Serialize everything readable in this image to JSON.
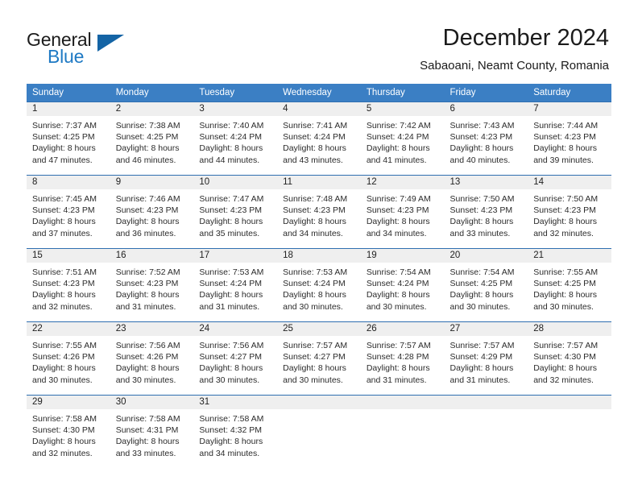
{
  "brand": {
    "name_part1": "General",
    "name_part2": "Blue",
    "triangle_icon": "triangle-icon",
    "color_dark": "#1b1b1b",
    "color_blue": "#1f7ac4",
    "triangle_color": "#1464a5"
  },
  "header": {
    "title": "December 2024",
    "subtitle": "Sabaoani, Neamt County, Romania"
  },
  "calendar": {
    "header_bg": "#3b7fc4",
    "header_text_color": "#ffffff",
    "daynum_band_bg": "#efefef",
    "row_border_color": "#2f6fb0",
    "weekdays": [
      "Sunday",
      "Monday",
      "Tuesday",
      "Wednesday",
      "Thursday",
      "Friday",
      "Saturday"
    ],
    "weeks": [
      [
        {
          "day": "1",
          "sunrise": "Sunrise: 7:37 AM",
          "sunset": "Sunset: 4:25 PM",
          "daylight_1": "Daylight: 8 hours",
          "daylight_2": "and 47 minutes."
        },
        {
          "day": "2",
          "sunrise": "Sunrise: 7:38 AM",
          "sunset": "Sunset: 4:25 PM",
          "daylight_1": "Daylight: 8 hours",
          "daylight_2": "and 46 minutes."
        },
        {
          "day": "3",
          "sunrise": "Sunrise: 7:40 AM",
          "sunset": "Sunset: 4:24 PM",
          "daylight_1": "Daylight: 8 hours",
          "daylight_2": "and 44 minutes."
        },
        {
          "day": "4",
          "sunrise": "Sunrise: 7:41 AM",
          "sunset": "Sunset: 4:24 PM",
          "daylight_1": "Daylight: 8 hours",
          "daylight_2": "and 43 minutes."
        },
        {
          "day": "5",
          "sunrise": "Sunrise: 7:42 AM",
          "sunset": "Sunset: 4:24 PM",
          "daylight_1": "Daylight: 8 hours",
          "daylight_2": "and 41 minutes."
        },
        {
          "day": "6",
          "sunrise": "Sunrise: 7:43 AM",
          "sunset": "Sunset: 4:23 PM",
          "daylight_1": "Daylight: 8 hours",
          "daylight_2": "and 40 minutes."
        },
        {
          "day": "7",
          "sunrise": "Sunrise: 7:44 AM",
          "sunset": "Sunset: 4:23 PM",
          "daylight_1": "Daylight: 8 hours",
          "daylight_2": "and 39 minutes."
        }
      ],
      [
        {
          "day": "8",
          "sunrise": "Sunrise: 7:45 AM",
          "sunset": "Sunset: 4:23 PM",
          "daylight_1": "Daylight: 8 hours",
          "daylight_2": "and 37 minutes."
        },
        {
          "day": "9",
          "sunrise": "Sunrise: 7:46 AM",
          "sunset": "Sunset: 4:23 PM",
          "daylight_1": "Daylight: 8 hours",
          "daylight_2": "and 36 minutes."
        },
        {
          "day": "10",
          "sunrise": "Sunrise: 7:47 AM",
          "sunset": "Sunset: 4:23 PM",
          "daylight_1": "Daylight: 8 hours",
          "daylight_2": "and 35 minutes."
        },
        {
          "day": "11",
          "sunrise": "Sunrise: 7:48 AM",
          "sunset": "Sunset: 4:23 PM",
          "daylight_1": "Daylight: 8 hours",
          "daylight_2": "and 34 minutes."
        },
        {
          "day": "12",
          "sunrise": "Sunrise: 7:49 AM",
          "sunset": "Sunset: 4:23 PM",
          "daylight_1": "Daylight: 8 hours",
          "daylight_2": "and 34 minutes."
        },
        {
          "day": "13",
          "sunrise": "Sunrise: 7:50 AM",
          "sunset": "Sunset: 4:23 PM",
          "daylight_1": "Daylight: 8 hours",
          "daylight_2": "and 33 minutes."
        },
        {
          "day": "14",
          "sunrise": "Sunrise: 7:50 AM",
          "sunset": "Sunset: 4:23 PM",
          "daylight_1": "Daylight: 8 hours",
          "daylight_2": "and 32 minutes."
        }
      ],
      [
        {
          "day": "15",
          "sunrise": "Sunrise: 7:51 AM",
          "sunset": "Sunset: 4:23 PM",
          "daylight_1": "Daylight: 8 hours",
          "daylight_2": "and 32 minutes."
        },
        {
          "day": "16",
          "sunrise": "Sunrise: 7:52 AM",
          "sunset": "Sunset: 4:23 PM",
          "daylight_1": "Daylight: 8 hours",
          "daylight_2": "and 31 minutes."
        },
        {
          "day": "17",
          "sunrise": "Sunrise: 7:53 AM",
          "sunset": "Sunset: 4:24 PM",
          "daylight_1": "Daylight: 8 hours",
          "daylight_2": "and 31 minutes."
        },
        {
          "day": "18",
          "sunrise": "Sunrise: 7:53 AM",
          "sunset": "Sunset: 4:24 PM",
          "daylight_1": "Daylight: 8 hours",
          "daylight_2": "and 30 minutes."
        },
        {
          "day": "19",
          "sunrise": "Sunrise: 7:54 AM",
          "sunset": "Sunset: 4:24 PM",
          "daylight_1": "Daylight: 8 hours",
          "daylight_2": "and 30 minutes."
        },
        {
          "day": "20",
          "sunrise": "Sunrise: 7:54 AM",
          "sunset": "Sunset: 4:25 PM",
          "daylight_1": "Daylight: 8 hours",
          "daylight_2": "and 30 minutes."
        },
        {
          "day": "21",
          "sunrise": "Sunrise: 7:55 AM",
          "sunset": "Sunset: 4:25 PM",
          "daylight_1": "Daylight: 8 hours",
          "daylight_2": "and 30 minutes."
        }
      ],
      [
        {
          "day": "22",
          "sunrise": "Sunrise: 7:55 AM",
          "sunset": "Sunset: 4:26 PM",
          "daylight_1": "Daylight: 8 hours",
          "daylight_2": "and 30 minutes."
        },
        {
          "day": "23",
          "sunrise": "Sunrise: 7:56 AM",
          "sunset": "Sunset: 4:26 PM",
          "daylight_1": "Daylight: 8 hours",
          "daylight_2": "and 30 minutes."
        },
        {
          "day": "24",
          "sunrise": "Sunrise: 7:56 AM",
          "sunset": "Sunset: 4:27 PM",
          "daylight_1": "Daylight: 8 hours",
          "daylight_2": "and 30 minutes."
        },
        {
          "day": "25",
          "sunrise": "Sunrise: 7:57 AM",
          "sunset": "Sunset: 4:27 PM",
          "daylight_1": "Daylight: 8 hours",
          "daylight_2": "and 30 minutes."
        },
        {
          "day": "26",
          "sunrise": "Sunrise: 7:57 AM",
          "sunset": "Sunset: 4:28 PM",
          "daylight_1": "Daylight: 8 hours",
          "daylight_2": "and 31 minutes."
        },
        {
          "day": "27",
          "sunrise": "Sunrise: 7:57 AM",
          "sunset": "Sunset: 4:29 PM",
          "daylight_1": "Daylight: 8 hours",
          "daylight_2": "and 31 minutes."
        },
        {
          "day": "28",
          "sunrise": "Sunrise: 7:57 AM",
          "sunset": "Sunset: 4:30 PM",
          "daylight_1": "Daylight: 8 hours",
          "daylight_2": "and 32 minutes."
        }
      ],
      [
        {
          "day": "29",
          "sunrise": "Sunrise: 7:58 AM",
          "sunset": "Sunset: 4:30 PM",
          "daylight_1": "Daylight: 8 hours",
          "daylight_2": "and 32 minutes."
        },
        {
          "day": "30",
          "sunrise": "Sunrise: 7:58 AM",
          "sunset": "Sunset: 4:31 PM",
          "daylight_1": "Daylight: 8 hours",
          "daylight_2": "and 33 minutes."
        },
        {
          "day": "31",
          "sunrise": "Sunrise: 7:58 AM",
          "sunset": "Sunset: 4:32 PM",
          "daylight_1": "Daylight: 8 hours",
          "daylight_2": "and 34 minutes."
        },
        {
          "day": "",
          "sunrise": "",
          "sunset": "",
          "daylight_1": "",
          "daylight_2": ""
        },
        {
          "day": "",
          "sunrise": "",
          "sunset": "",
          "daylight_1": "",
          "daylight_2": ""
        },
        {
          "day": "",
          "sunrise": "",
          "sunset": "",
          "daylight_1": "",
          "daylight_2": ""
        },
        {
          "day": "",
          "sunrise": "",
          "sunset": "",
          "daylight_1": "",
          "daylight_2": ""
        }
      ]
    ]
  }
}
